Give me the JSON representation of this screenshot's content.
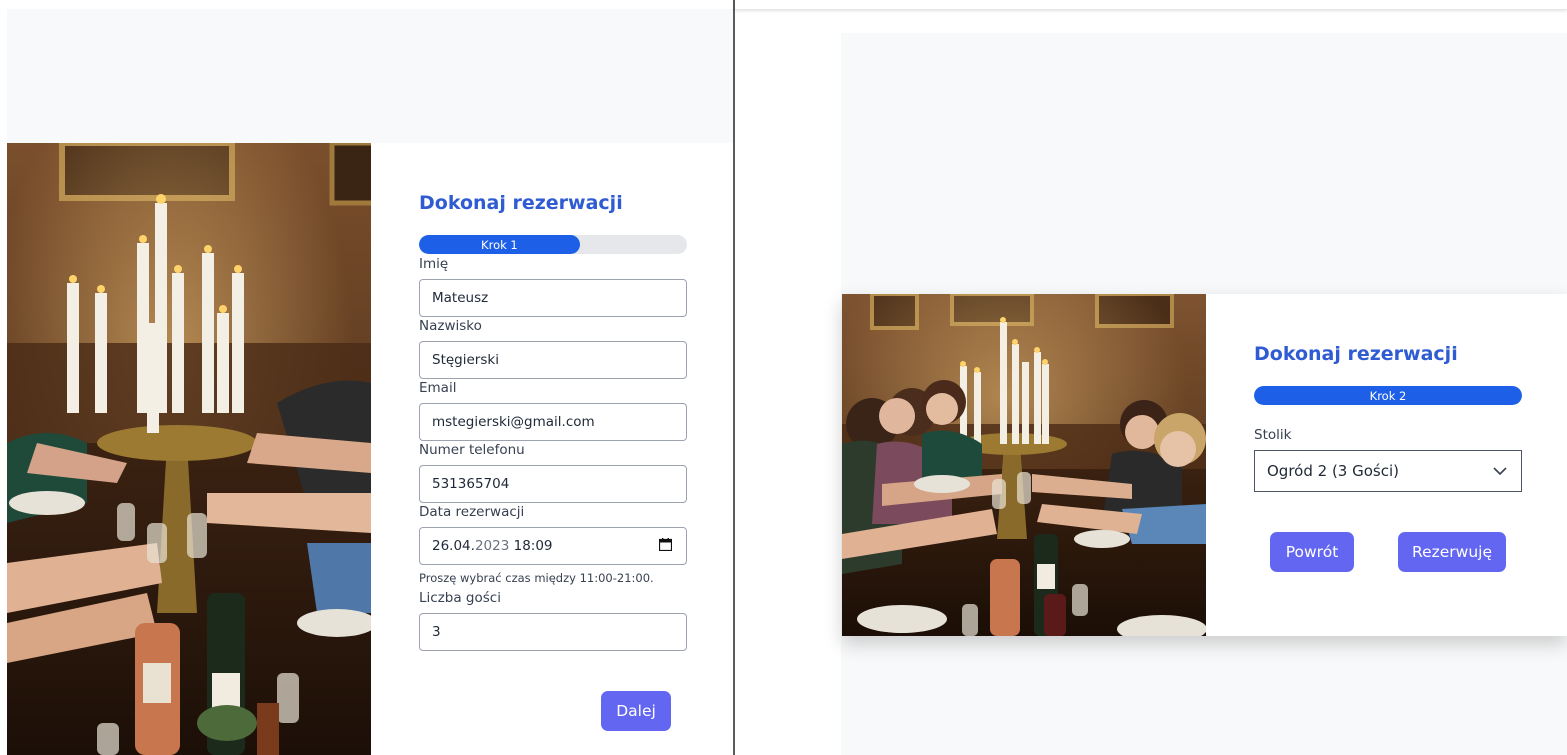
{
  "left_form": {
    "title": "Dokonaj rezerwacji",
    "progress": {
      "label": "Krok 1",
      "fraction": 0.6
    },
    "fields": [
      {
        "label": "Imię",
        "value": "Mateusz"
      },
      {
        "label": "Nazwisko",
        "value": "Stęgierski"
      },
      {
        "label": "Email",
        "value": "mstegierski@gmail.com"
      },
      {
        "label": "Numer telefonu",
        "value": "531365704"
      },
      {
        "label": "Data rezerwacji",
        "date_day_month": "26.04.",
        "date_year": "2023",
        "time": "18:09"
      },
      {
        "label": "Liczba gości",
        "value": "3"
      }
    ],
    "date_hint": "Proszę wybrać czas między 11:00-21:00.",
    "next_button": "Dalej"
  },
  "right_form": {
    "title": "Dokonaj rezerwacji",
    "progress": {
      "label": "Krok 2",
      "fraction": 1.0
    },
    "table_label": "Stolik",
    "table_selected": "Ogród 2 (3 Gości)",
    "back_button": "Powrót",
    "submit_button": "Rezerwuję"
  },
  "colors": {
    "accent_blue": "#2f5bd3",
    "progress_blue": "#1d5fe6",
    "button_indigo": "#6366f1",
    "page_bg": "#f8f9fa"
  }
}
